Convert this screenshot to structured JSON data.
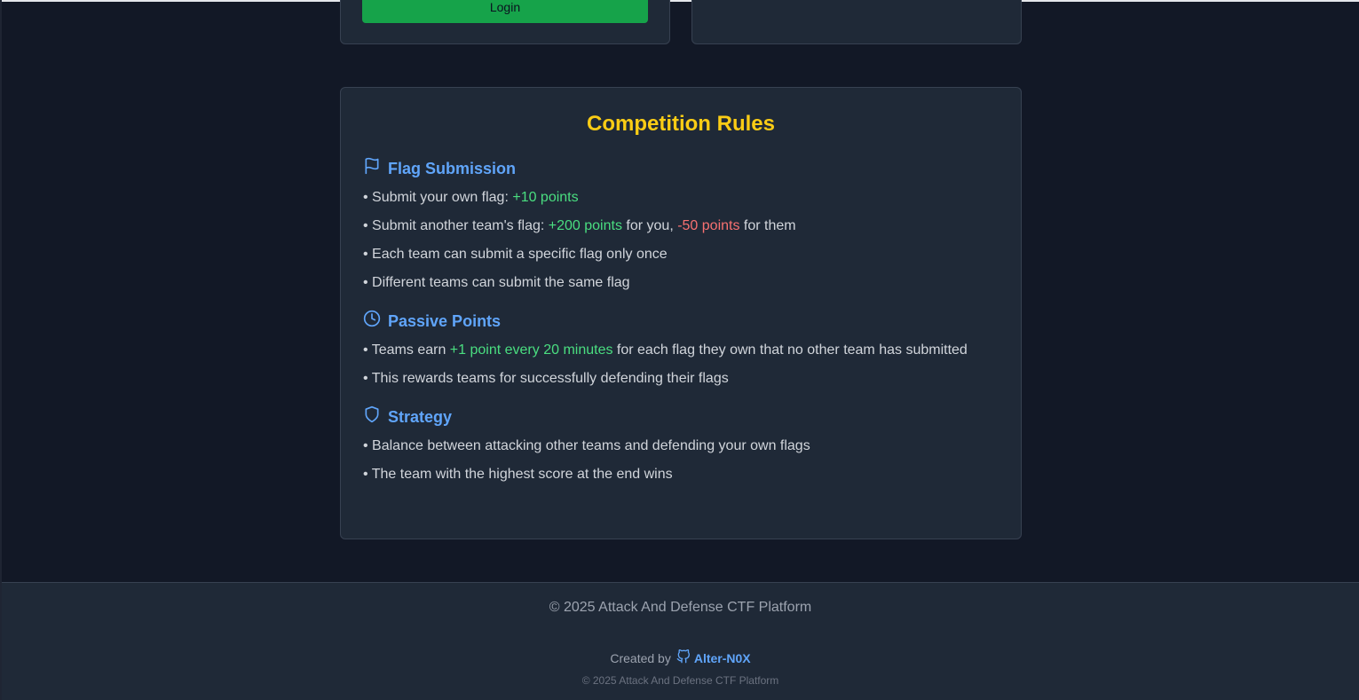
{
  "login_card": {
    "button_label": "Login"
  },
  "rules": {
    "title": "Competition Rules",
    "sections": [
      {
        "icon": "flag-icon",
        "title": "Flag Submission",
        "items": [
          {
            "prefix": "• Submit your own flag: ",
            "hl1": "+10 points"
          },
          {
            "prefix": "• Submit another team's flag: ",
            "hl1": "+200 points",
            "mid": " for you, ",
            "hl2": "-50 points",
            "suffix": " for them"
          },
          {
            "text": "• Each team can submit a specific flag only once"
          },
          {
            "text": "• Different teams can submit the same flag"
          }
        ]
      },
      {
        "icon": "clock-icon",
        "title": "Passive Points",
        "items": [
          {
            "prefix": "• Teams earn ",
            "hl1": "+1 point every 20 minutes",
            "suffix": " for each flag they own that no other team has submitted"
          },
          {
            "text": "• This rewards teams for successfully defending their flags"
          }
        ]
      },
      {
        "icon": "shield-icon",
        "title": "Strategy",
        "items": [
          {
            "text": "• Balance between attacking other teams and defending your own flags"
          },
          {
            "text": "• The team with the highest score at the end wins"
          }
        ]
      }
    ]
  },
  "footer": {
    "copyright": "© 2025 Attack And Defense CTF Platform",
    "created_by": "Created by",
    "author": "Alter-N0X",
    "author_icon": "github-icon",
    "small_copyright": "© 2025 Attack And Defense CTF Platform"
  },
  "colors": {
    "background": "#121826",
    "card": "#1f2937",
    "title": "#facc15",
    "section": "#60a5fa",
    "positive": "#4ade80",
    "negative": "#f87171",
    "button": "#16a34a"
  }
}
